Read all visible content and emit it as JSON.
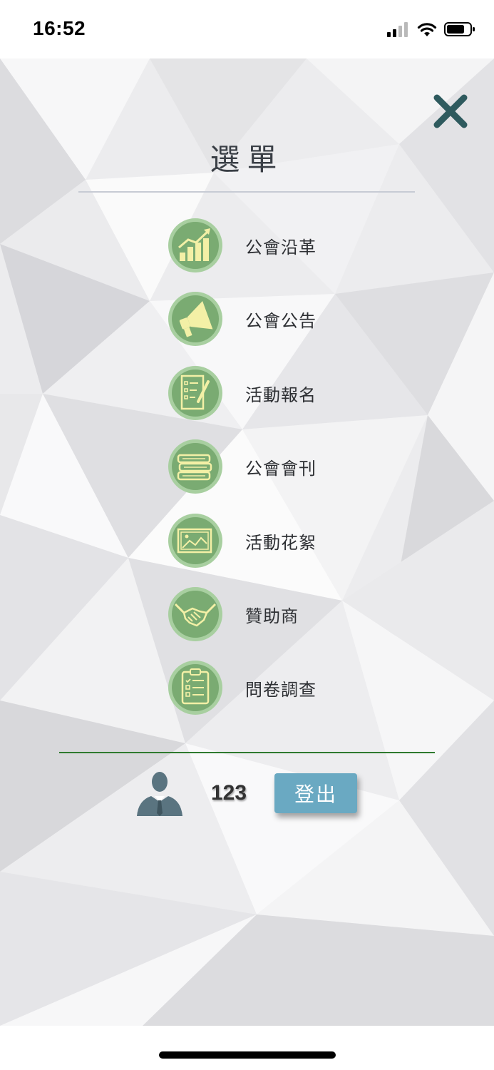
{
  "status_bar": {
    "time": "16:52",
    "icons": [
      "signal-icon",
      "wifi-icon",
      "battery-icon"
    ]
  },
  "menu": {
    "title": "選單",
    "close_icon": "close-icon",
    "items": [
      {
        "label": "公會沿革",
        "icon": "growth-chart-icon"
      },
      {
        "label": "公會公告",
        "icon": "megaphone-icon"
      },
      {
        "label": "活動報名",
        "icon": "checklist-pen-icon"
      },
      {
        "label": "公會會刊",
        "icon": "books-icon"
      },
      {
        "label": "活動花絮",
        "icon": "picture-icon"
      },
      {
        "label": "贊助商",
        "icon": "handshake-icon"
      },
      {
        "label": "問卷調查",
        "icon": "clipboard-icon"
      }
    ]
  },
  "user": {
    "name": "123",
    "avatar_icon": "businessman-avatar-icon",
    "logout_label": "登出"
  },
  "colors": {
    "icon_circle": "#7aab72",
    "icon_ring": "#a8cfa0",
    "icon_glyph": "#f3f0a6",
    "close_icon": "#2e5a5e",
    "divider_green": "#2f7a2f",
    "logout_button": "#6aa9c2"
  }
}
